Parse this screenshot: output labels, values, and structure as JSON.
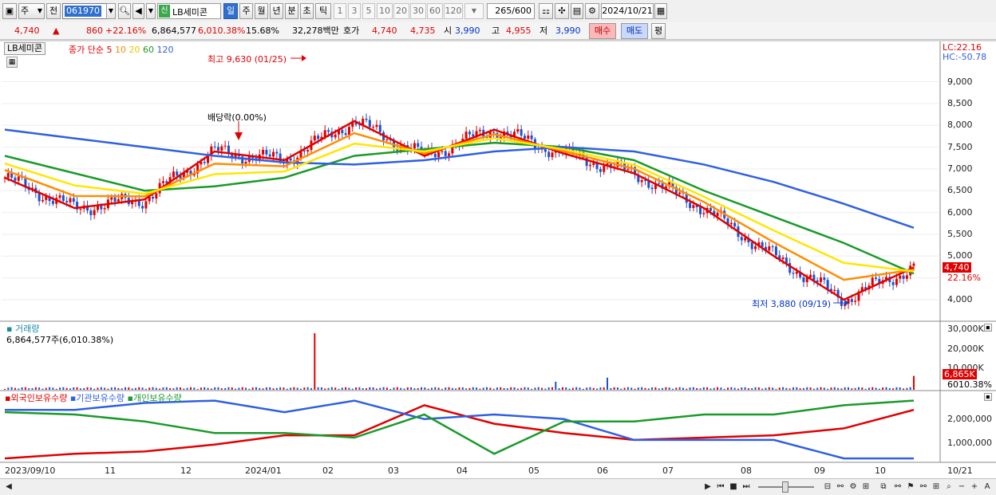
{
  "toolbar": {
    "period_type": "주",
    "prefix": "전",
    "code": "061970",
    "stock_badge": "신",
    "stock_name": "LB세미콘",
    "periods": [
      "일",
      "주",
      "월",
      "년",
      "분",
      "초",
      "틱"
    ],
    "active_period": "일",
    "intervals": [
      "1",
      "3",
      "5",
      "10",
      "20",
      "30",
      "60",
      "120"
    ],
    "count": "265",
    "count_total": "/600",
    "date": "2024/10/21"
  },
  "quote": {
    "price": "4,740",
    "change": "860",
    "change_pct": "+22.16%",
    "volume": "6,864,577",
    "volume_ratio": "6,010.38%",
    "turnover": "15.68%",
    "amount": "32,278백만",
    "bid_label": "호가",
    "ask": "4,740",
    "bid": "4,735",
    "open_label": "시",
    "open": "3,990",
    "high_label": "고",
    "high": "4,955",
    "low_label": "저",
    "low": "3,990",
    "buy_label": "매수",
    "sell_label": "매도",
    "avg_label": "평"
  },
  "price_panel": {
    "name": "LB세미콘",
    "legend_title": "종가 단순",
    "ma_periods": [
      "5",
      "10",
      "20",
      "60",
      "120"
    ],
    "ma_colors": [
      "#e00000",
      "#ff8c00",
      "#ffe600",
      "#1a9a2a",
      "#3060e0"
    ],
    "annot_high": "최고 9,630 (01/25)",
    "annot_dividend": "배당락(0.00%)",
    "annot_low": "최저 3,880 (09/19)",
    "lc": "LC:22.16",
    "hc": "HC:-50.78",
    "last_price_tag": "4,740",
    "last_pct_tag": "22.16%",
    "y_ticks": [
      "9,000",
      "8,500",
      "8,000",
      "7,500",
      "7,000",
      "6,500",
      "6,000",
      "5,500",
      "5,000",
      "4,000"
    ]
  },
  "volume_panel": {
    "title": "거래량",
    "value": "6,864,577주(6,010.38%)",
    "y_ticks": [
      "30,000K",
      "20,000K",
      "10,000K"
    ],
    "last_tag": "6,865K",
    "last_pct": "6010.38%"
  },
  "holding_panel": {
    "series": [
      "외국인보유수량",
      "기관보유수량",
      "개인보유수량"
    ],
    "colors": [
      "#e00000",
      "#3060e0",
      "#1a9a2a"
    ],
    "y_ticks": [
      "2,000,000",
      "1,000,000"
    ]
  },
  "x_axis": {
    "labels": [
      "2023/09/10",
      "11",
      "12",
      "2024/01",
      "02",
      "03",
      "04",
      "05",
      "06",
      "07",
      "08",
      "09",
      "10",
      "10/21"
    ]
  },
  "chart_data": {
    "type": "line",
    "title": "LB세미콘",
    "ylim": [
      3800,
      9700
    ],
    "x": [
      "2023/09",
      "2023/10",
      "2023/11",
      "2023/12",
      "2024/01",
      "2024/02",
      "2024/03",
      "2024/04",
      "2024/05",
      "2024/06",
      "2024/07",
      "2024/08",
      "2024/09",
      "2024/10"
    ],
    "series": [
      {
        "name": "5",
        "values": [
          6800,
          6100,
          6300,
          7400,
          7200,
          8100,
          7300,
          7900,
          7350,
          6900,
          6100,
          5000,
          4000,
          4740
        ]
      },
      {
        "name": "60",
        "values": [
          7300,
          6900,
          6500,
          6600,
          6800,
          7300,
          7450,
          7600,
          7500,
          7200,
          6500,
          5900,
          5300,
          4600
        ]
      },
      {
        "name": "120",
        "values": [
          7900,
          7700,
          7500,
          7300,
          7150,
          7100,
          7200,
          7400,
          7500,
          7400,
          7100,
          6700,
          6200,
          5650
        ]
      }
    ],
    "volume_peak_k": 28000,
    "last_volume_k": 6865
  }
}
